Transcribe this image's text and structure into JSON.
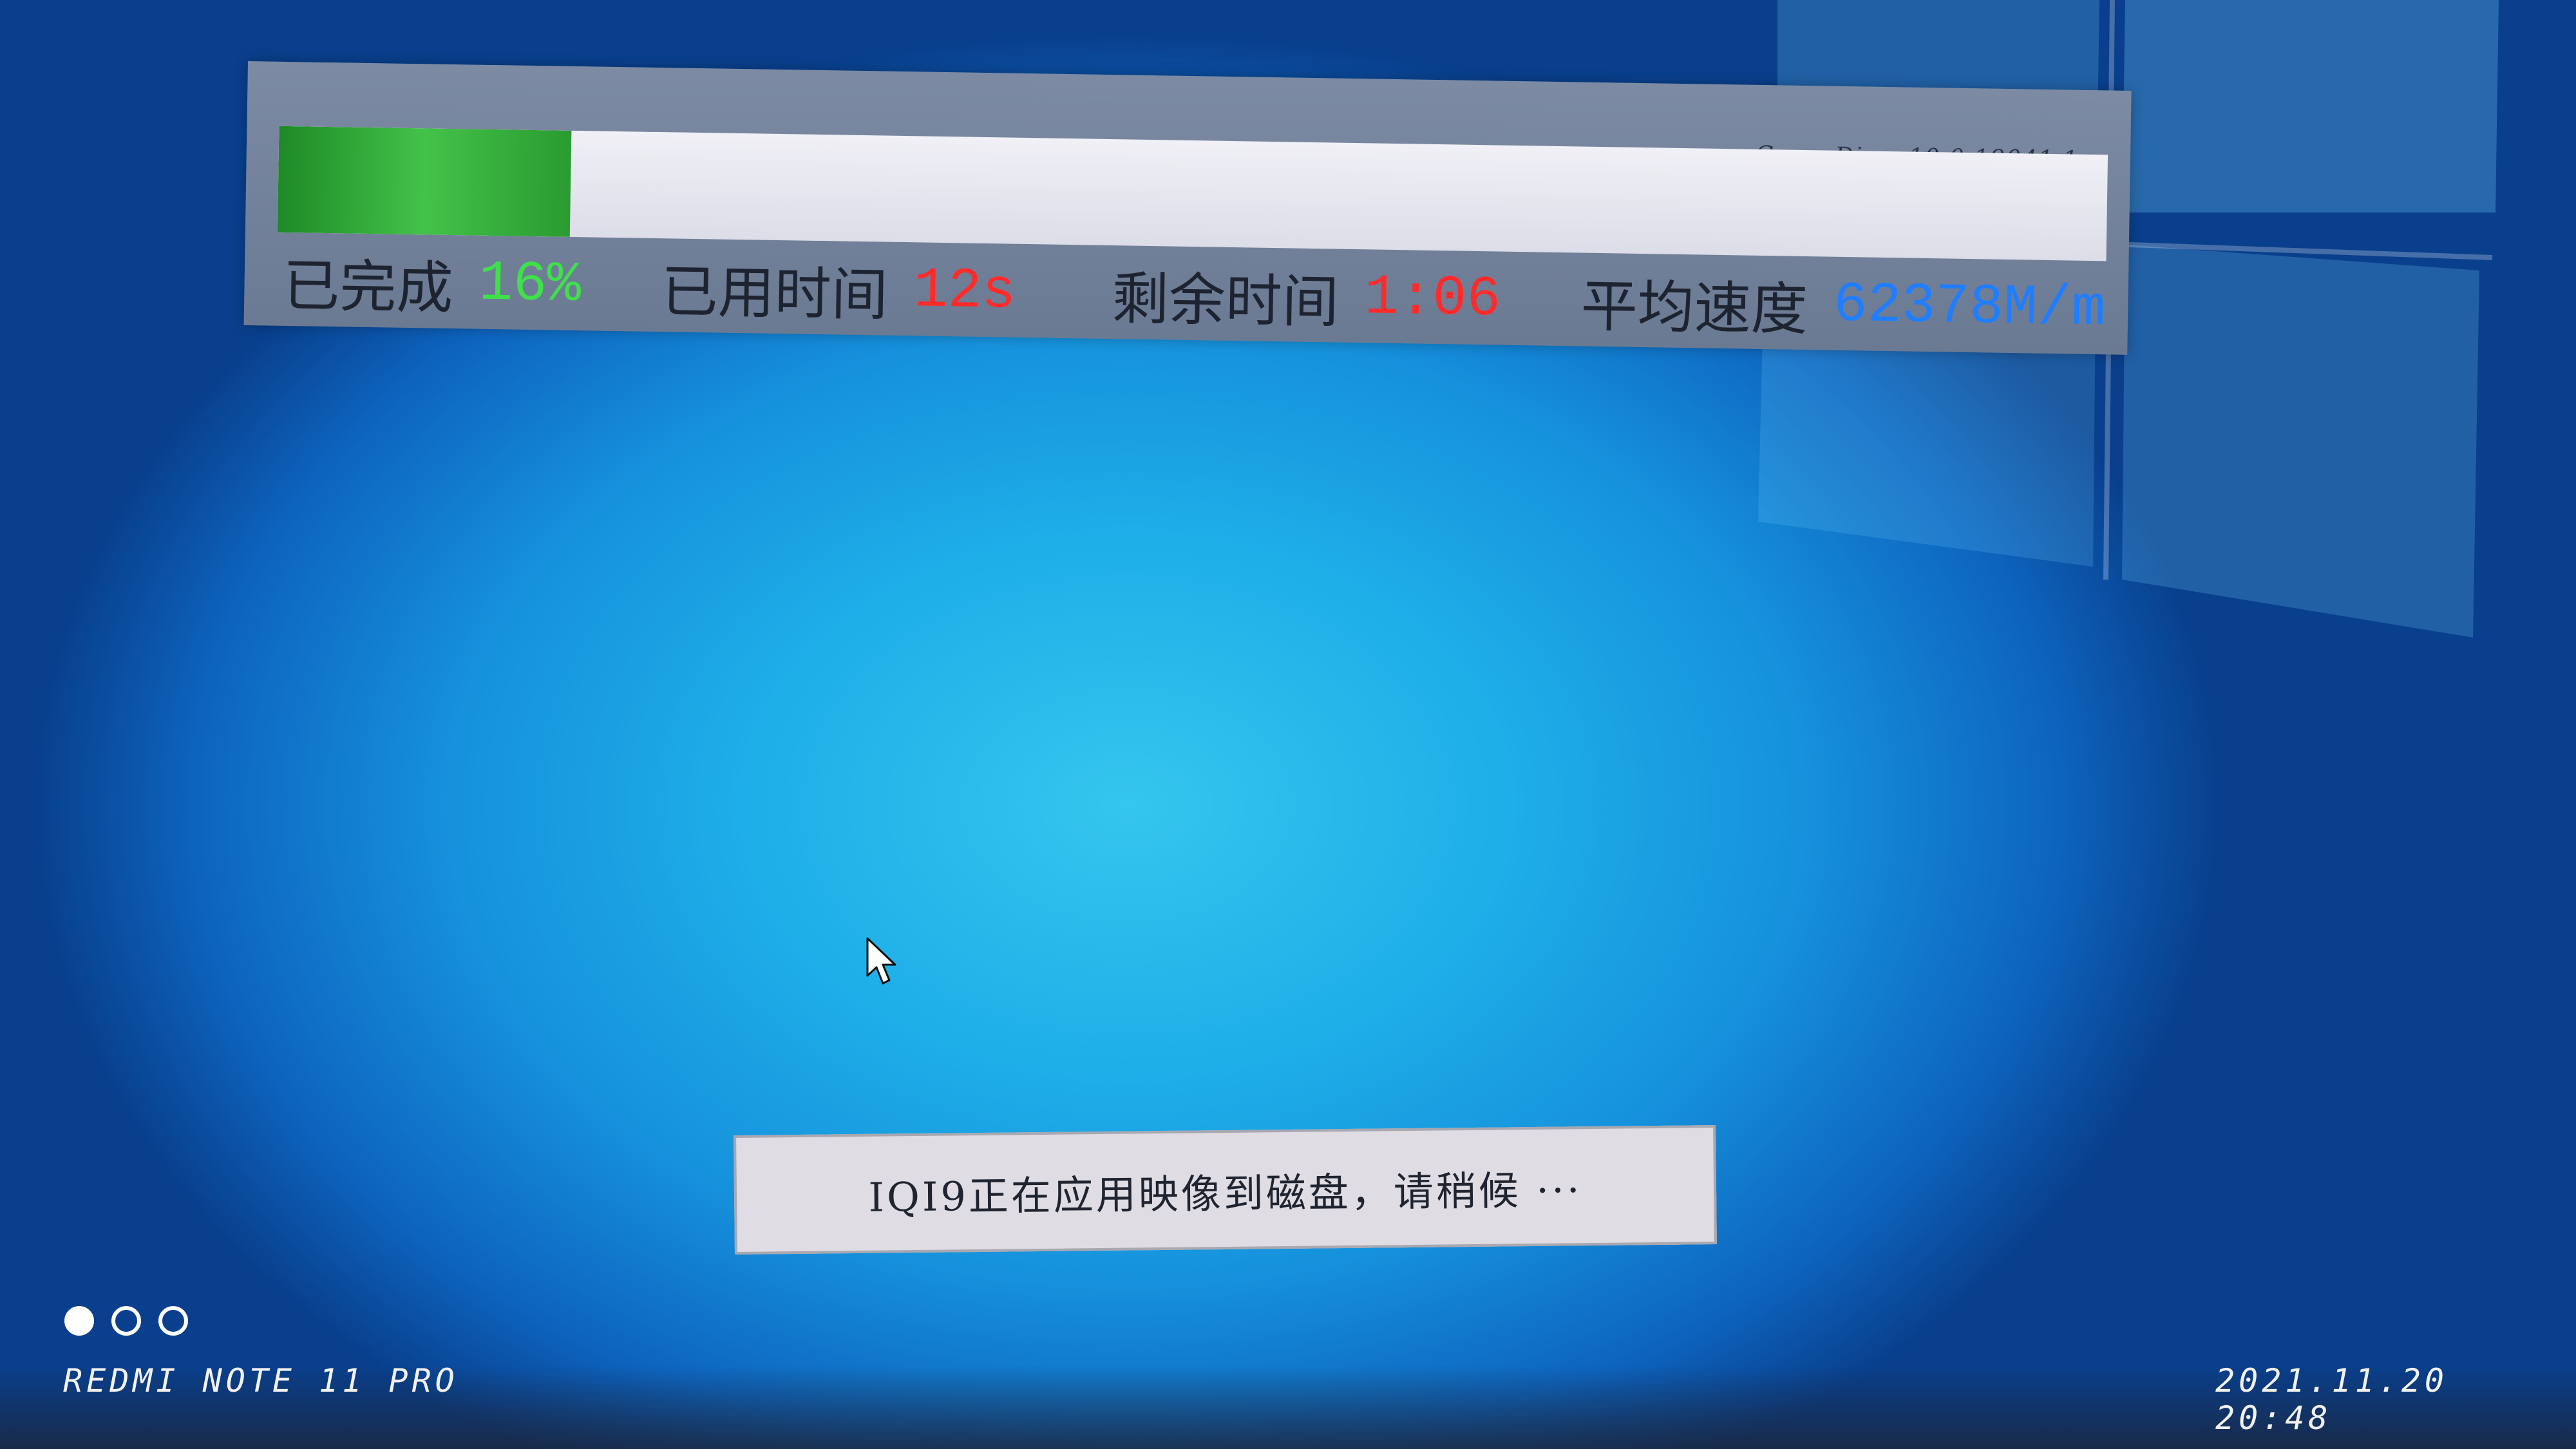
{
  "progress": {
    "core_label": "Core: Dism 10.0.19041.1",
    "fraction": 0.16,
    "stats": [
      {
        "label": "已完成",
        "value": "16%",
        "color": "#3fe04a"
      },
      {
        "label": "已用时间",
        "value": "12s",
        "color": "#ff2a2a"
      },
      {
        "label": "剩余时间",
        "value": "1:06",
        "color": "#ff2a2a"
      },
      {
        "label": "平均速度",
        "value": "62378M/m",
        "color": "#1f7dff"
      }
    ]
  },
  "status": {
    "message": "IQI9正在应用映像到磁盘，请稍候 ···"
  },
  "watermark": {
    "device": "REDMI NOTE 11 PRO",
    "datetime": "2021.11.20  20:48"
  },
  "icons": [
    "windows-logo-icon",
    "mouse-cursor-icon",
    "camera-dots-icon"
  ],
  "colors": {
    "progress_fill": "#2fae36",
    "background": "#1eaee8"
  }
}
